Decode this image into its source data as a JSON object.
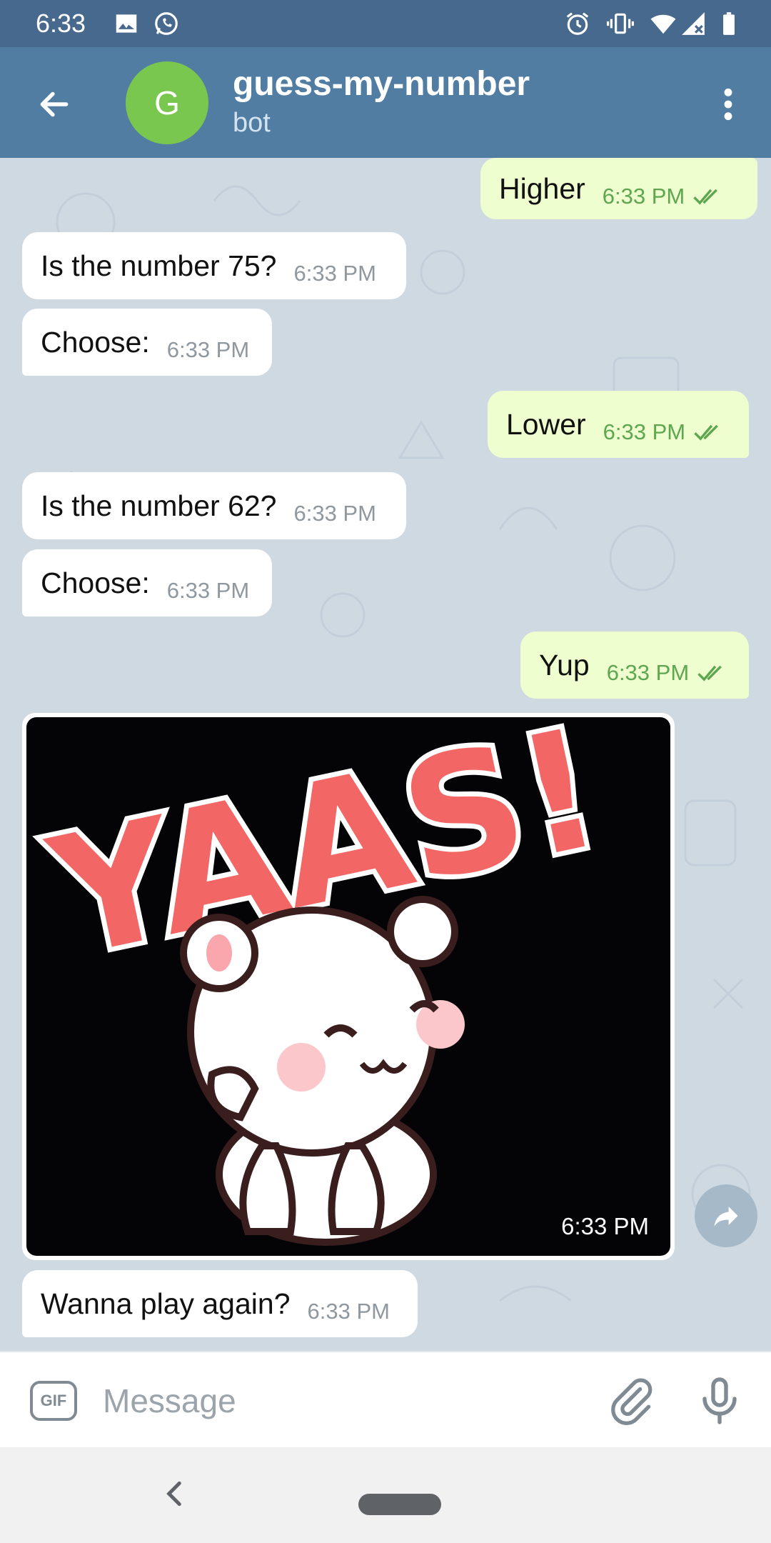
{
  "status_bar": {
    "time": "6:33",
    "icons": [
      "image-icon",
      "whatsapp-icon",
      "alarm-icon",
      "vibrate-icon",
      "wifi-icon",
      "signal-icon",
      "battery-icon"
    ]
  },
  "header": {
    "avatar_letter": "G",
    "title": "guess-my-number",
    "subtitle": "bot",
    "icons": [
      "back-arrow-icon",
      "more-vert-icon"
    ],
    "colors": {
      "status_bar": "#46698d",
      "app_bar": "#527da3",
      "avatar": "#7ac74f"
    }
  },
  "messages": [
    {
      "side": "out",
      "text": "Higher",
      "time": "6:33 PM",
      "read": true
    },
    {
      "side": "in",
      "text": "Is the number 75?",
      "time": "6:33 PM"
    },
    {
      "side": "in",
      "text": "Choose:",
      "time": "6:33 PM"
    },
    {
      "side": "out",
      "text": "Lower",
      "time": "6:33 PM",
      "read": true
    },
    {
      "side": "in",
      "text": "Is the number 62?",
      "time": "6:33 PM"
    },
    {
      "side": "in",
      "text": "Choose:",
      "time": "6:33 PM"
    },
    {
      "side": "out",
      "text": "Yup",
      "time": "6:33 PM",
      "read": true
    },
    {
      "side": "in",
      "type": "gif",
      "text": "YAAS!",
      "time": "6:33 PM"
    },
    {
      "side": "in",
      "text": "Wanna play again?",
      "time": "6:33 PM"
    }
  ],
  "composer": {
    "gif_label": "GIF",
    "placeholder": "Message",
    "icons": [
      "gif-icon",
      "attach-icon",
      "mic-icon"
    ]
  },
  "colors": {
    "chat_background": "#cfd9e2",
    "incoming_bubble": "#ffffff",
    "outgoing_bubble": "#eefecf",
    "outgoing_meta": "#5fa650"
  }
}
